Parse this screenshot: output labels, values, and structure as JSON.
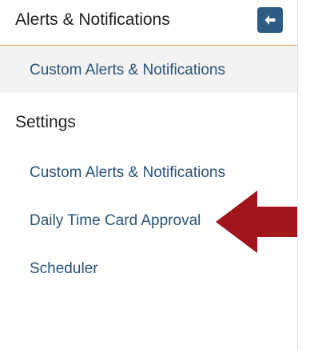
{
  "header": {
    "title": "Alerts & Notifications",
    "collapse_icon": "arrow-left-icon"
  },
  "active_item": {
    "label": "Custom Alerts & Notifications"
  },
  "settings": {
    "title": "Settings",
    "items": [
      {
        "label": "Custom Alerts & Notifications"
      },
      {
        "label": "Daily Time Card Approval"
      },
      {
        "label": "Scheduler"
      }
    ]
  },
  "colors": {
    "header_divider": "#e0a44a",
    "button_bg": "#2a5c84",
    "link": "#2a5377",
    "pointer_arrow": "#a3151c",
    "active_bg": "#f3f3f3"
  }
}
